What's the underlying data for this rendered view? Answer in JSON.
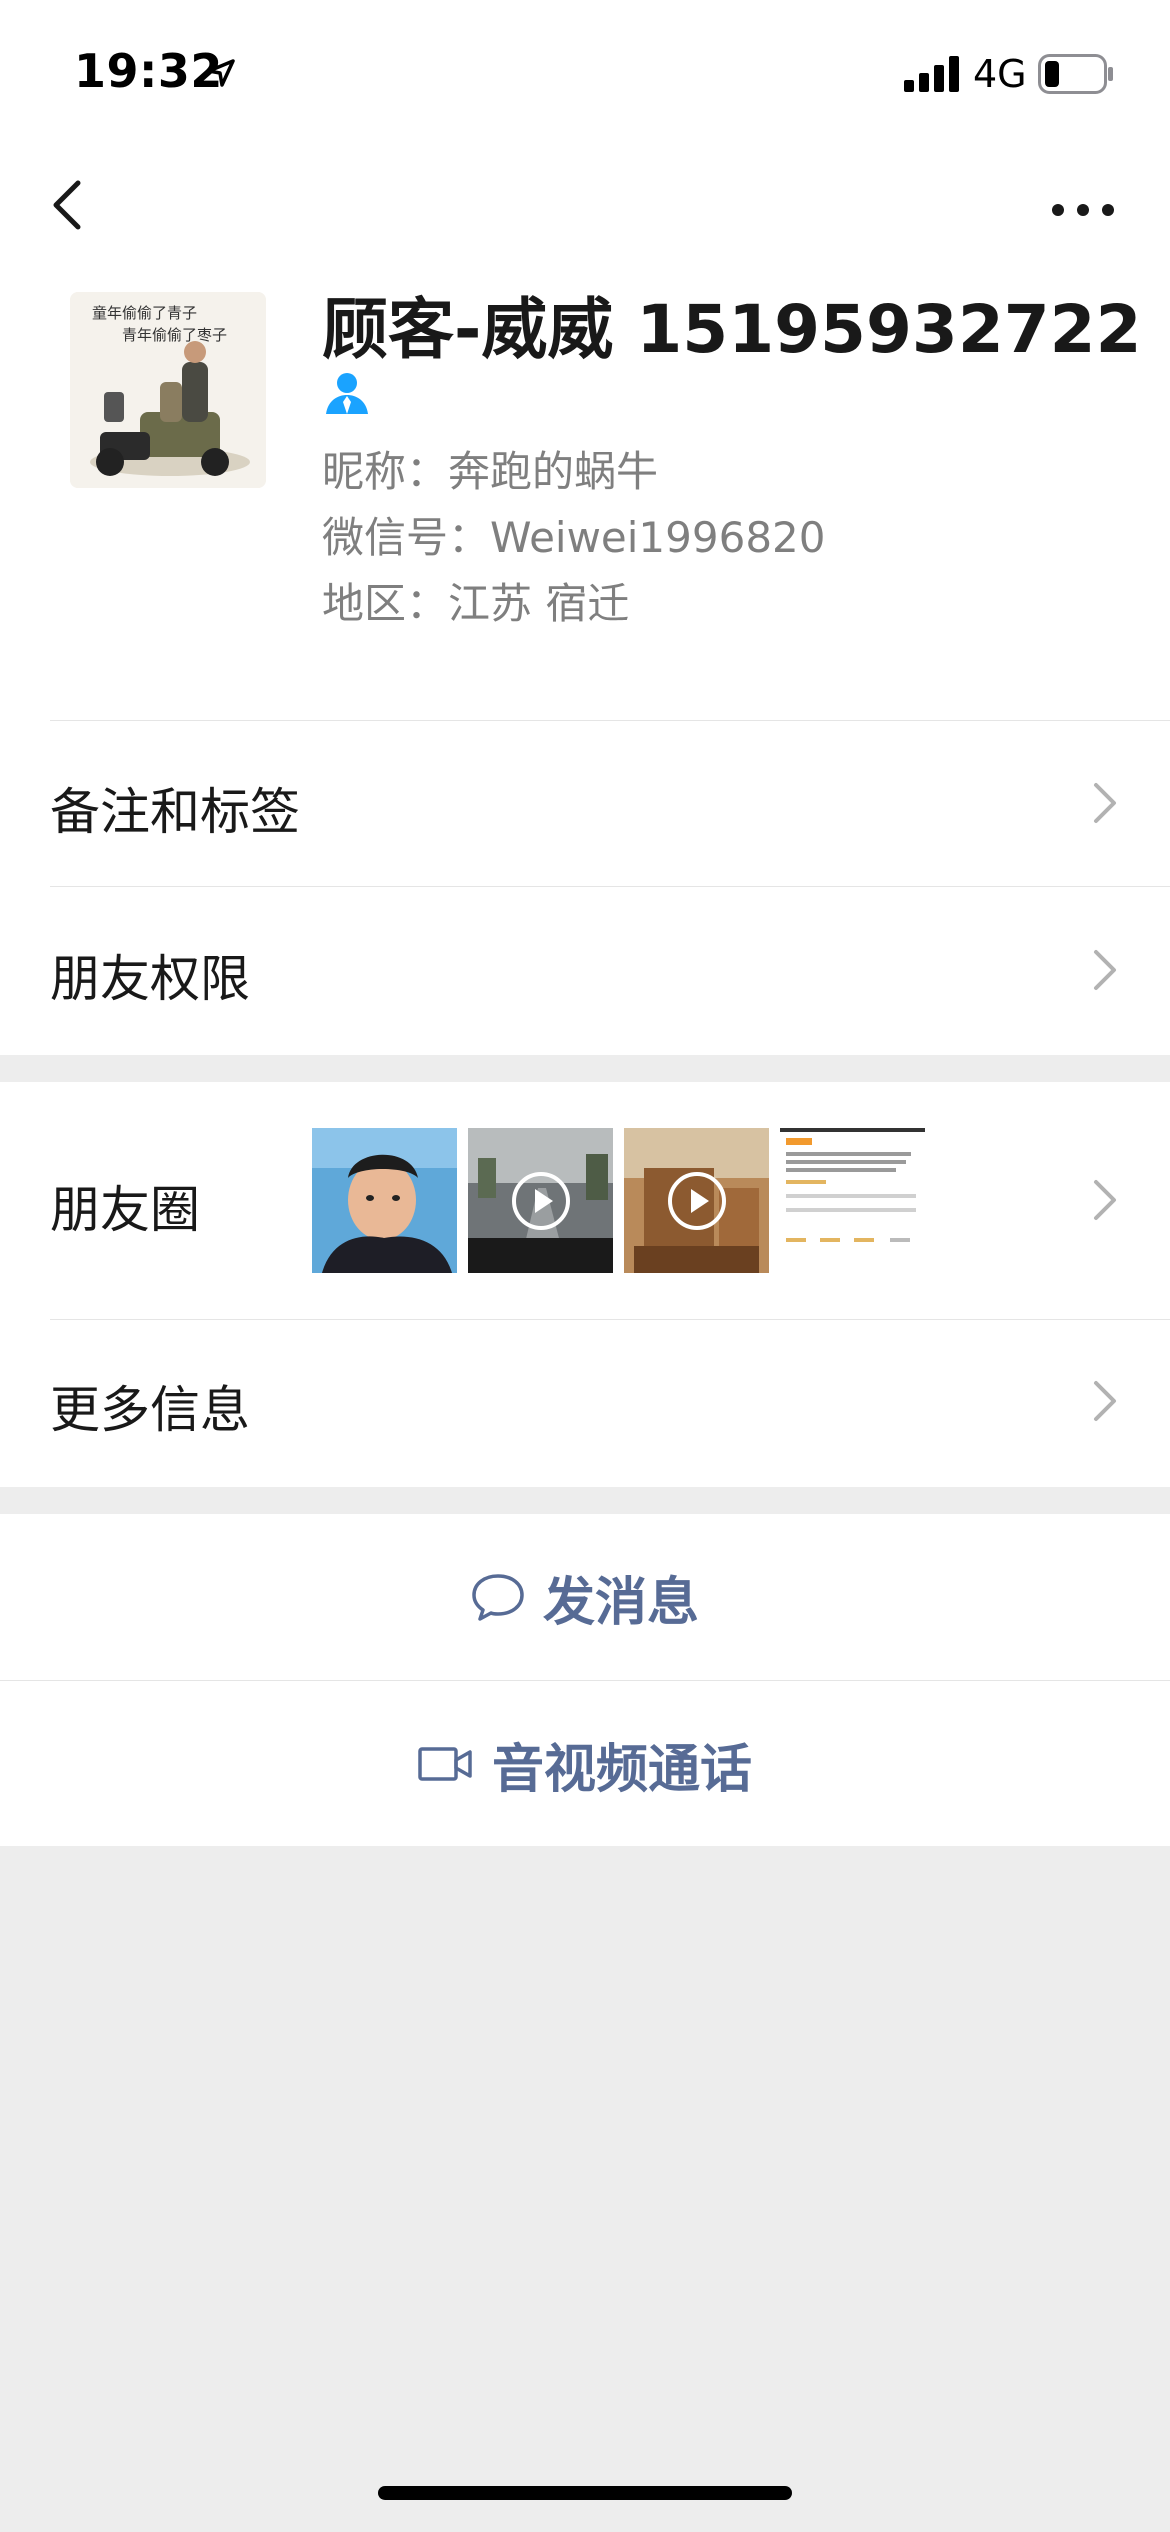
{
  "status_bar": {
    "time": "19:32",
    "network": "4G",
    "battery_level": 0.25
  },
  "nav": {
    "back_icon": "chevron-left-icon",
    "more_icon": "ellipsis-icon"
  },
  "profile": {
    "display_name": "顾客-威威 15195932722",
    "nickname_line": "昵称：奔跑的蜗牛",
    "wechat_id_line": "微信号：Weiwei1996820",
    "region_line": "地区：江苏 宿迁",
    "contact_type_icon": "person-icon",
    "avatar_caption_1": "童年偷偷了青子",
    "avatar_caption_2": "青年偷偷了枣子"
  },
  "rows": {
    "remarks_tags": "备注和标签",
    "friend_permissions": "朋友权限",
    "moments": "朋友圈",
    "more_info": "更多信息"
  },
  "moments_thumbnails": [
    {
      "type": "photo",
      "subject": "selfie"
    },
    {
      "type": "video",
      "subject": "road"
    },
    {
      "type": "video",
      "subject": "furniture"
    },
    {
      "type": "screenshot",
      "subject": "listing"
    }
  ],
  "actions": {
    "send_message": "发消息",
    "av_call": "音视频通话"
  },
  "colors": {
    "link_blue": "#576b95",
    "contact_icon_blue": "#1aa3ff",
    "background": "#ededed",
    "text_secondary": "#7f7f7f"
  }
}
